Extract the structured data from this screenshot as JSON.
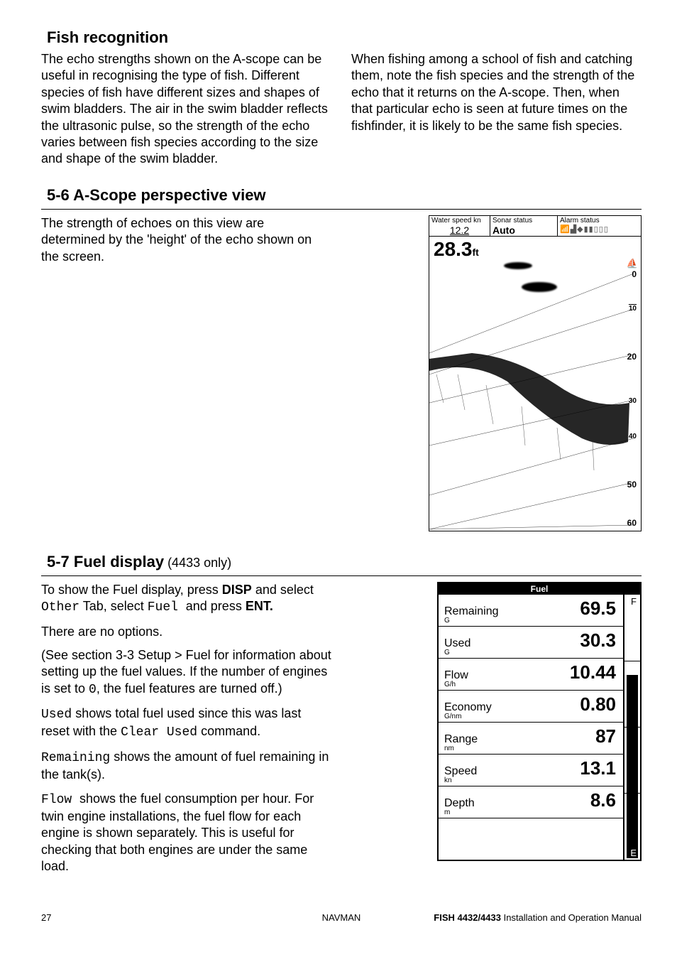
{
  "section1": {
    "title": "Fish recognition",
    "colA": "The echo strengths shown on the A-scope can be useful in recognising the type of fish. Different species of fish have different sizes and shapes of swim bladders. The air in the swim bladder reflects the ultrasonic pulse, so the strength of the echo varies between fish species according to the size and shape of the swim bladder.",
    "colB": "When fishing among a school of fish and catching them, note the fish species and the strength of the echo that it returns on the A-scope. Then, when that particular echo is seen at future times on the fishfinder, it is likely to be the same fish species."
  },
  "section2": {
    "title": "5-6 A-Scope perspective view",
    "text": "The strength of echoes on this view are determined by the 'height' of the echo shown on the screen.",
    "ascope": {
      "waterSpeedLbl": "Water speed  kn",
      "waterSpeedVal": "12.2",
      "sonarLbl": "Sonar status",
      "sonarVal": "Auto",
      "alarmLbl": "Alarm status",
      "depthVal": "28.3",
      "depthUnit": "ft",
      "scale": [
        "0",
        "10",
        "20",
        "30",
        "40",
        "50",
        "60"
      ]
    }
  },
  "section3": {
    "title": "5-7 Fuel display",
    "note": " (4433 only)",
    "p1a": "To show the Fuel display, press ",
    "p1b": "DISP",
    "p1c": " and select ",
    "p1d": "Other",
    "p1e": " Tab, select ",
    "p1f": "Fuel ",
    "p1g": " and press ",
    "p1h": "ENT.",
    "p2": "There are no options.",
    "p3a": "(See section 3-3 Setup > Fuel for information about setting up the fuel values. If the number of engines is set to ",
    "p3b": "0",
    "p3c": ", the fuel features are turned off.)",
    "p4a": "Used",
    "p4b": " shows total fuel used since this was last reset with the ",
    "p4c": "Clear Used",
    "p4d": " command.",
    "p5a": "Remaining",
    "p5b": " shows the amount of fuel remaining in the tank(s).",
    "p6a": "Flow ",
    "p6b": " shows the fuel consumption per hour. For twin engine installations, the fuel flow for each engine is shown separately. This is useful for checking that both engines are under the same load.",
    "fuel": {
      "title": "Fuel",
      "rows": [
        {
          "lbl": "Remaining",
          "unit": "G",
          "val": "69.5"
        },
        {
          "lbl": "Used",
          "unit": "G",
          "val": "30.3"
        },
        {
          "lbl": "Flow",
          "unit": "G/h",
          "val": "10.44"
        },
        {
          "lbl": "Economy",
          "unit": "G/nm",
          "val": "0.80"
        },
        {
          "lbl": "Range",
          "unit": "nm",
          "val": "87"
        },
        {
          "lbl": "Speed",
          "unit": "kn",
          "val": "13.1"
        },
        {
          "lbl": "Depth",
          "unit": "m",
          "val": "8.6"
        }
      ],
      "top": "F",
      "bot": "E"
    }
  },
  "footer": {
    "page": "27",
    "center": "NAVMAN",
    "rightBold": "FISH 4432/4433",
    "rightRest": " Installation and Operation Manual"
  }
}
